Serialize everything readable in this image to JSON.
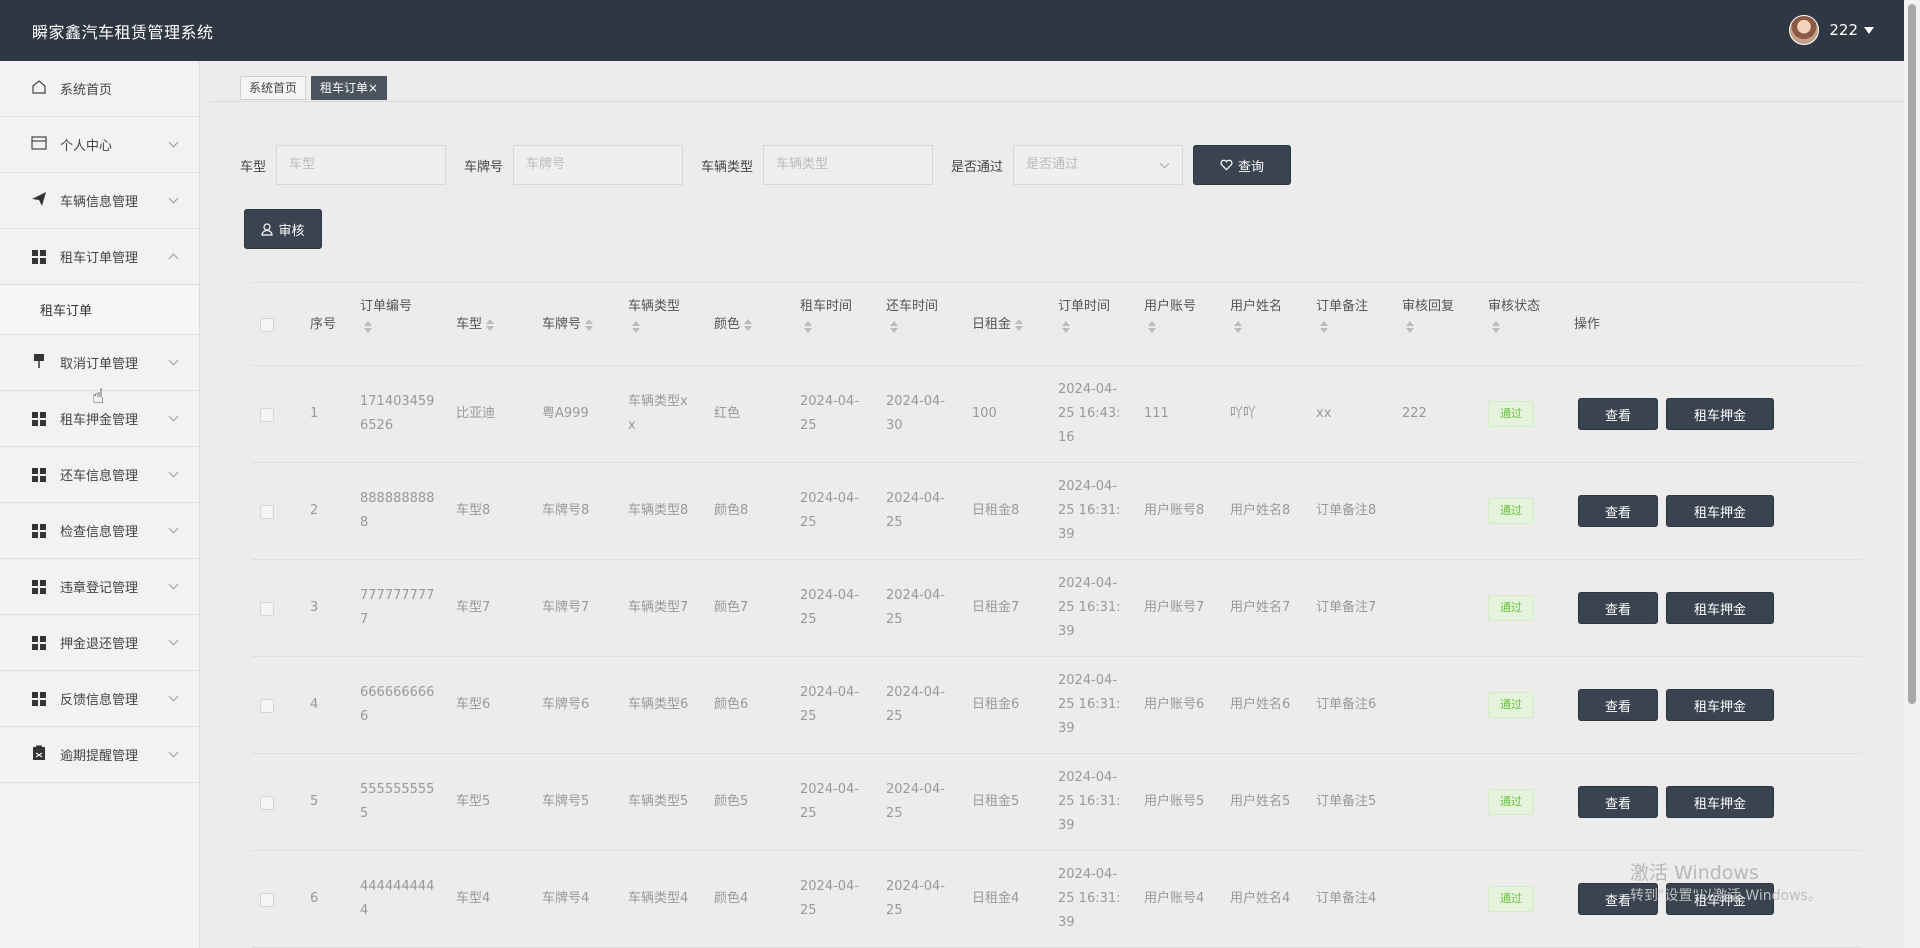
{
  "header": {
    "title": "瞬家鑫汽车租赁管理系统",
    "username": "222"
  },
  "sidebar": {
    "items": [
      {
        "label": "系统首页",
        "icon": "home-icon"
      },
      {
        "label": "个人中心",
        "icon": "card-icon"
      },
      {
        "label": "车辆信息管理",
        "icon": "send-icon"
      },
      {
        "label": "租车订单管理",
        "icon": "grid-icon",
        "expanded": true
      },
      {
        "label": "取消订单管理",
        "icon": "pin-icon"
      },
      {
        "label": "租车押金管理",
        "icon": "grid-icon"
      },
      {
        "label": "还车信息管理",
        "icon": "grid-icon"
      },
      {
        "label": "检查信息管理",
        "icon": "grid-icon"
      },
      {
        "label": "违章登记管理",
        "icon": "grid-icon"
      },
      {
        "label": "押金退还管理",
        "icon": "grid-icon"
      },
      {
        "label": "反馈信息管理",
        "icon": "grid-icon"
      },
      {
        "label": "逾期提醒管理",
        "icon": "clipboard-icon"
      }
    ],
    "submenu": {
      "label": "租车订单"
    }
  },
  "tabs": [
    {
      "label": "系统首页"
    },
    {
      "label": "租车订单×"
    }
  ],
  "filters": {
    "car_model_label": "车型",
    "car_model_placeholder": "车型",
    "plate_label": "车牌号",
    "plate_placeholder": "车牌号",
    "type_label": "车辆类型",
    "type_placeholder": "车辆类型",
    "approved_label": "是否通过",
    "approved_placeholder": "是否通过",
    "search_label": "查询"
  },
  "audit_label": "审核",
  "table": {
    "headers": {
      "index": "序号",
      "order_no": "订单编号",
      "model": "车型",
      "plate": "车牌号",
      "type": "车辆类型",
      "color": "颜色",
      "rent_time": "租车时间",
      "return_time": "还车时间",
      "daily_rent": "日租金",
      "order_time": "订单时间",
      "user_account": "用户账号",
      "user_name": "用户姓名",
      "order_note": "订单备注",
      "audit_reply": "审核回复",
      "audit_status": "审核状态",
      "actions": "操作"
    },
    "view_label": "查看",
    "deposit_label": "租车押金",
    "rows": [
      {
        "index": "1",
        "order_no_1": "171403459",
        "order_no_2": "6526",
        "model": "比亚迪",
        "plate": "粤A999",
        "type_1": "车辆类型x",
        "type_2": "x",
        "color": "红色",
        "rent_1": "2024-04-",
        "rent_2": "25",
        "return_1": "2024-04-",
        "return_2": "30",
        "daily": "100",
        "ot_1": "2024-04-",
        "ot_2": "25 16:43:",
        "ot_3": "16",
        "account": "111",
        "name": "吖吖",
        "note": "xx",
        "reply": "222",
        "status": "通过"
      },
      {
        "index": "2",
        "order_no_1": "888888888",
        "order_no_2": "8",
        "model": "车型8",
        "plate": "车牌号8",
        "type_1": "车辆类型8",
        "type_2": "",
        "color": "颜色8",
        "rent_1": "2024-04-",
        "rent_2": "25",
        "return_1": "2024-04-",
        "return_2": "25",
        "daily": "日租金8",
        "ot_1": "2024-04-",
        "ot_2": "25 16:31:",
        "ot_3": "39",
        "account": "用户账号8",
        "name": "用户姓名8",
        "note": "订单备注8",
        "reply": "",
        "status": "通过"
      },
      {
        "index": "3",
        "order_no_1": "777777777",
        "order_no_2": "7",
        "model": "车型7",
        "plate": "车牌号7",
        "type_1": "车辆类型7",
        "type_2": "",
        "color": "颜色7",
        "rent_1": "2024-04-",
        "rent_2": "25",
        "return_1": "2024-04-",
        "return_2": "25",
        "daily": "日租金7",
        "ot_1": "2024-04-",
        "ot_2": "25 16:31:",
        "ot_3": "39",
        "account": "用户账号7",
        "name": "用户姓名7",
        "note": "订单备注7",
        "reply": "",
        "status": "通过"
      },
      {
        "index": "4",
        "order_no_1": "666666666",
        "order_no_2": "6",
        "model": "车型6",
        "plate": "车牌号6",
        "type_1": "车辆类型6",
        "type_2": "",
        "color": "颜色6",
        "rent_1": "2024-04-",
        "rent_2": "25",
        "return_1": "2024-04-",
        "return_2": "25",
        "daily": "日租金6",
        "ot_1": "2024-04-",
        "ot_2": "25 16:31:",
        "ot_3": "39",
        "account": "用户账号6",
        "name": "用户姓名6",
        "note": "订单备注6",
        "reply": "",
        "status": "通过"
      },
      {
        "index": "5",
        "order_no_1": "555555555",
        "order_no_2": "5",
        "model": "车型5",
        "plate": "车牌号5",
        "type_1": "车辆类型5",
        "type_2": "",
        "color": "颜色5",
        "rent_1": "2024-04-",
        "rent_2": "25",
        "return_1": "2024-04-",
        "return_2": "25",
        "daily": "日租金5",
        "ot_1": "2024-04-",
        "ot_2": "25 16:31:",
        "ot_3": "39",
        "account": "用户账号5",
        "name": "用户姓名5",
        "note": "订单备注5",
        "reply": "",
        "status": "通过"
      },
      {
        "index": "6",
        "order_no_1": "444444444",
        "order_no_2": "4",
        "model": "车型4",
        "plate": "车牌号4",
        "type_1": "车辆类型4",
        "type_2": "",
        "color": "颜色4",
        "rent_1": "2024-04-",
        "rent_2": "25",
        "return_1": "2024-04-",
        "return_2": "25",
        "daily": "日租金4",
        "ot_1": "2024-04-",
        "ot_2": "25 16:31:",
        "ot_3": "39",
        "account": "用户账号4",
        "name": "用户姓名4",
        "note": "订单备注4",
        "reply": "",
        "status": "通过"
      }
    ]
  },
  "watermark": {
    "line1": "激活 Windows",
    "line2": "转到\"设置\"以激活 Windows。"
  },
  "colors": {
    "header_bg": "#2f3743",
    "button_dark": "#3a4350",
    "status_green": "#67c23a"
  }
}
